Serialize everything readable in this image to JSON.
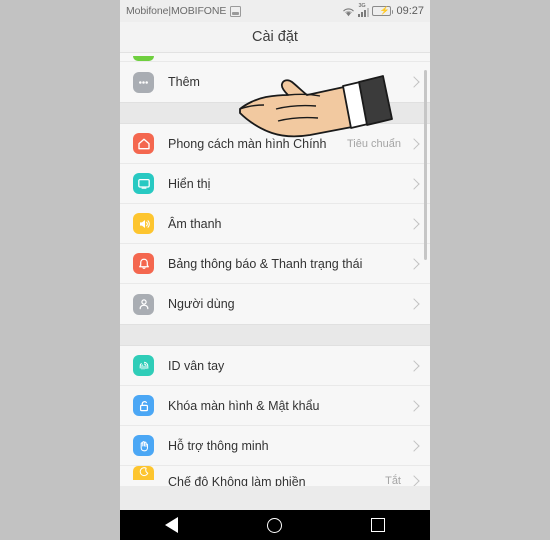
{
  "status_bar": {
    "carrier": "Mobifone|MOBIFONE",
    "screenshot_icon": "screenshot-icon",
    "wifi_icon": "wifi-icon",
    "network_type": "3G",
    "battery_icon": "battery-charging-icon",
    "time": "09:27"
  },
  "header": {
    "title": "Cài đặt"
  },
  "groups": [
    {
      "rows": [
        {
          "label": "",
          "value": "",
          "icon": "green-app-icon",
          "icon_class": "ic-green",
          "clip": "top"
        },
        {
          "label": "Thêm",
          "value": "",
          "icon": "more-dots-icon",
          "icon_class": "ic-grey",
          "clip": "none"
        }
      ]
    },
    {
      "rows": [
        {
          "label": "Phong cách màn hình Chính",
          "value": "Tiêu chuẩn",
          "icon": "home-icon",
          "icon_class": "ic-coral",
          "clip": "none"
        },
        {
          "label": "Hiển thị",
          "value": "",
          "icon": "display-icon",
          "icon_class": "ic-teal",
          "clip": "none"
        },
        {
          "label": "Âm thanh",
          "value": "",
          "icon": "speaker-icon",
          "icon_class": "ic-yellow",
          "clip": "none"
        },
        {
          "label": "Bảng thông báo & Thanh trạng thái",
          "value": "",
          "icon": "bell-icon",
          "icon_class": "ic-coral",
          "clip": "none"
        },
        {
          "label": "Người dùng",
          "value": "",
          "icon": "person-icon",
          "icon_class": "ic-person",
          "clip": "none"
        }
      ]
    },
    {
      "rows": [
        {
          "label": "ID vân tay",
          "value": "",
          "icon": "fingerprint-icon",
          "icon_class": "ic-mint",
          "clip": "none"
        },
        {
          "label": "Khóa màn hình & Mật khẩu",
          "value": "",
          "icon": "lock-icon",
          "icon_class": "ic-blue",
          "clip": "none"
        },
        {
          "label": "Hỗ trợ thông minh",
          "value": "",
          "icon": "hand-assist-icon",
          "icon_class": "ic-blue",
          "clip": "none"
        },
        {
          "label": "Chế độ Không làm phiền",
          "value": "Tắt",
          "icon": "moon-icon",
          "icon_class": "ic-yellow",
          "clip": "bottom"
        }
      ]
    }
  ],
  "cursor": {
    "name": "pointing-hand-cursor"
  },
  "nav_bar": {
    "back": "back-icon",
    "home": "home-icon",
    "recents": "recents-icon"
  },
  "colors": {
    "page_bg": "#c2c2c2",
    "screen_bg": "#f7f7f7",
    "accent_coral": "#f4674f",
    "accent_teal": "#28c9c2",
    "accent_yellow": "#fdc52f",
    "accent_blue": "#4ba7f5",
    "battery_green": "#5cc24a"
  }
}
